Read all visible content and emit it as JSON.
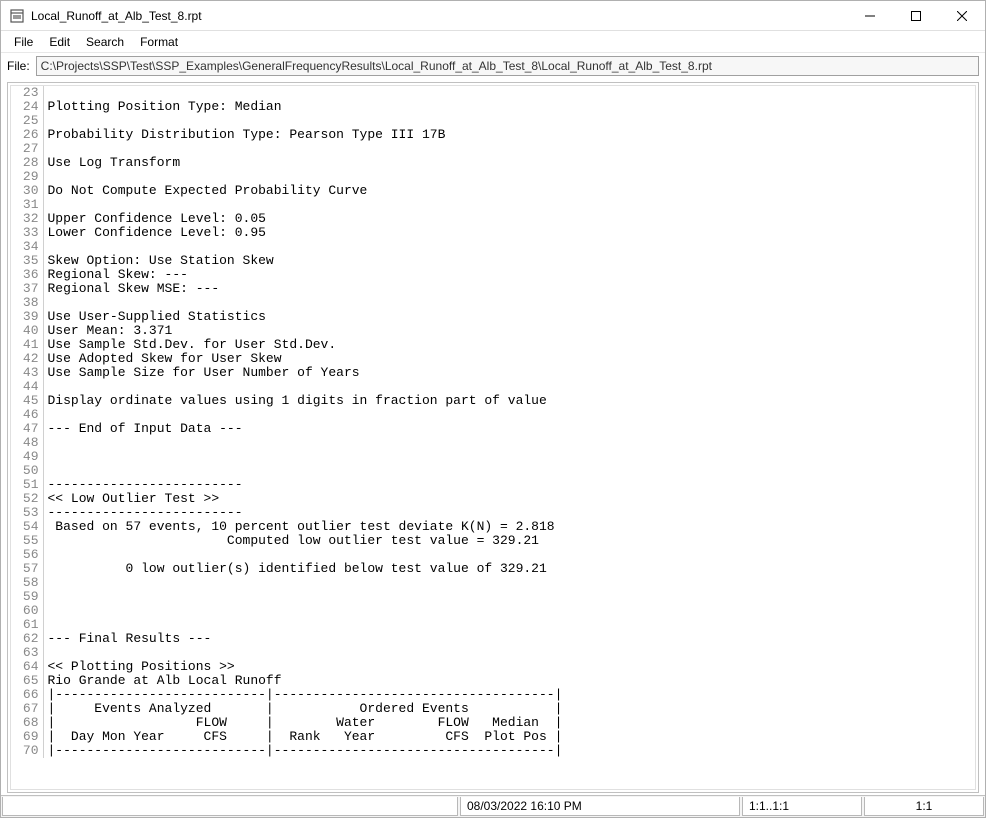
{
  "window": {
    "title": "Local_Runoff_at_Alb_Test_8.rpt"
  },
  "menu": {
    "file": "File",
    "edit": "Edit",
    "search": "Search",
    "format": "Format"
  },
  "pathbar": {
    "label": "File:",
    "value": "C:\\Projects\\SSP\\Test\\SSP_Examples\\GeneralFrequencyResults\\Local_Runoff_at_Alb_Test_8\\Local_Runoff_at_Alb_Test_8.rpt"
  },
  "editor": {
    "firstLineNumber": 23,
    "lines": [
      "",
      "Plotting Position Type: Median",
      "",
      "Probability Distribution Type: Pearson Type III 17B",
      "",
      "Use Log Transform",
      "",
      "Do Not Compute Expected Probability Curve",
      "",
      "Upper Confidence Level: 0.05",
      "Lower Confidence Level: 0.95",
      "",
      "Skew Option: Use Station Skew",
      "Regional Skew: ---",
      "Regional Skew MSE: ---",
      "",
      "Use User-Supplied Statistics",
      "User Mean: 3.371",
      "Use Sample Std.Dev. for User Std.Dev.",
      "Use Adopted Skew for User Skew",
      "Use Sample Size for User Number of Years",
      "",
      "Display ordinate values using 1 digits in fraction part of value",
      "",
      "--- End of Input Data ---",
      "",
      "",
      "",
      "-------------------------",
      "<< Low Outlier Test >>",
      "-------------------------",
      " Based on 57 events, 10 percent outlier test deviate K(N) = 2.818",
      "                       Computed low outlier test value = 329.21",
      "",
      "          0 low outlier(s) identified below test value of 329.21",
      "",
      "",
      "",
      "",
      "--- Final Results ---",
      "",
      "<< Plotting Positions >>",
      "Rio Grande at Alb Local Runoff",
      "|---------------------------|------------------------------------|",
      "|     Events Analyzed       |           Ordered Events           |",
      "|                  FLOW     |        Water        FLOW   Median  |",
      "|  Day Mon Year     CFS     |  Rank   Year         CFS  Plot Pos |",
      "|---------------------------|------------------------------------|"
    ]
  },
  "status": {
    "c1": "",
    "c2": "08/03/2022 16:10 PM",
    "c3": "1:1..1:1",
    "c4": "1:1"
  }
}
